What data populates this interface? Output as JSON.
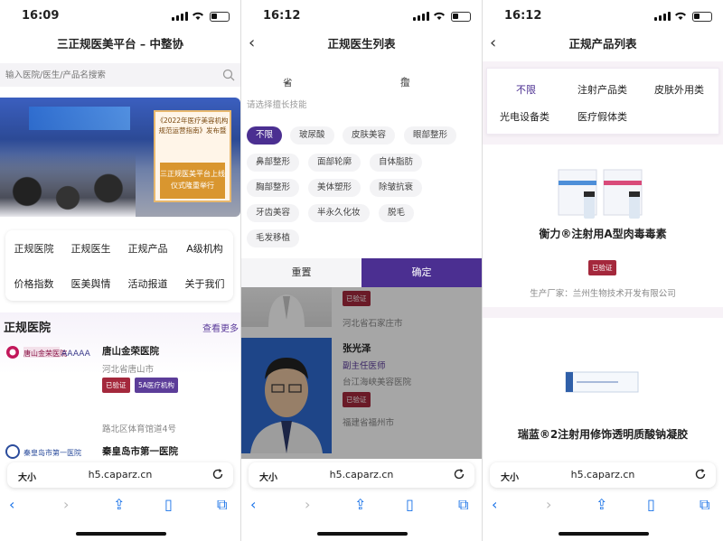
{
  "status": {
    "p1_time": "16:09",
    "p2_time": "16:12",
    "p3_time": "16:12"
  },
  "browser": {
    "text_size": "大小",
    "url": "h5.caparz.cn"
  },
  "colors": {
    "accent": "#4b2f91",
    "verified": "#a4283c",
    "link_blue": "#1a73e8"
  },
  "icons": {
    "search": "search-icon",
    "back": "chevron-left-icon",
    "reload": "reload-icon",
    "share": "share-icon",
    "bookmarks": "book-icon",
    "tabs": "tabs-icon"
  },
  "p1": {
    "title": "三正规医美平台 – 中整协",
    "search_placeholder": "输入医院/医生/产品名搜索",
    "banner": {
      "card_text": "《2022年医疗美容机构规范运营指南》发布暨",
      "card_highlight": "三正规医美平台上线仪式隆重举行"
    },
    "menu": [
      "正规医院",
      "正规医生",
      "正规产品",
      "A级机构",
      "价格指数",
      "医美舆情",
      "活动报道",
      "关于我们"
    ],
    "section_title": "正规医院",
    "section_more": "查看更多",
    "hospitals": [
      {
        "name": "唐山金荣医院",
        "city": "河北省唐山市",
        "badges": [
          "已验证",
          "5A医疗机构"
        ],
        "address": "路北区体育馆道4号",
        "logo_text": "唐山金荣医院"
      },
      {
        "name": "秦皇岛市第一医院",
        "logo_text": "秦皇岛市第一医院"
      }
    ]
  },
  "p2": {
    "title": "正规医生列表",
    "tabs": [
      "省份",
      "擅长技能"
    ],
    "hint": "请选择擅长技能",
    "tags": [
      "不限",
      "玻尿酸",
      "皮肤美容",
      "眼部整形",
      "鼻部整形",
      "面部轮廓",
      "自体脂肪",
      "胸部整形",
      "美体塑形",
      "除皱抗衰",
      "牙齿美容",
      "半永久化妆",
      "脱毛",
      "毛发移植"
    ],
    "reset": "重置",
    "confirm": "确定",
    "doctors": [
      {
        "badge": "已验证",
        "city": "河北省石家庄市"
      },
      {
        "name": "张光泽",
        "title": "副主任医师",
        "hospital": "台江海峡美容医院",
        "badge": "已验证",
        "city": "福建省福州市"
      }
    ]
  },
  "p3": {
    "title": "正规产品列表",
    "categories": [
      "不限",
      "注射产品类",
      "皮肤外用类",
      "光电设备类",
      "医疗假体类"
    ],
    "products": [
      {
        "name": "衡力®注射用A型肉毒毒素",
        "badge": "已验证",
        "maker": "生产厂家：兰州生物技术开发有限公司"
      },
      {
        "name": "瑞蓝®2注射用修饰透明质酸钠凝胶"
      }
    ]
  }
}
